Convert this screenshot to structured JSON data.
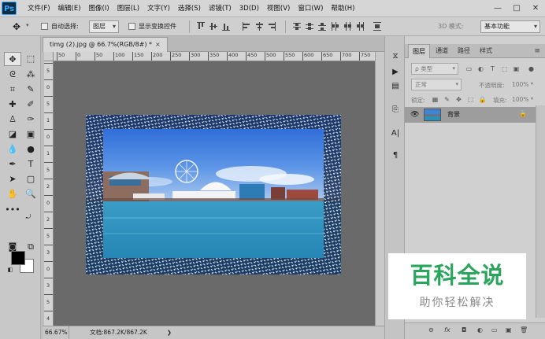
{
  "app": {
    "logo": "Ps",
    "menu": [
      "文件(F)",
      "编辑(E)",
      "图像(I)",
      "图层(L)",
      "文字(Y)",
      "选择(S)",
      "滤镜(T)",
      "3D(D)",
      "视图(V)",
      "窗口(W)",
      "帮助(H)"
    ],
    "window_buttons": [
      "—",
      "□",
      "✕"
    ]
  },
  "options": {
    "auto_select_label": "自动选择:",
    "auto_select_target": "图层",
    "show_transform_label": "显示变换控件",
    "mode_3d_label": "3D 模式:",
    "workspace": "基本功能"
  },
  "document": {
    "tab_title": "timg (2).jpg @ 66.7%(RGB/8#) *",
    "tab_close": "×",
    "ruler_h_ticks": [
      "50",
      "0",
      "50",
      "100",
      "150",
      "200",
      "250",
      "300",
      "350",
      "400",
      "450",
      "500",
      "550",
      "600",
      "650",
      "700",
      "750"
    ],
    "ruler_v_ticks": [
      "5",
      "0",
      "5",
      "1",
      "0",
      "1",
      "5",
      "2",
      "0",
      "2",
      "5",
      "3",
      "0",
      "3",
      "5",
      "4"
    ],
    "colors": {
      "water": "#2f8dbe",
      "sky": "#3d7fe0",
      "frame_noise": "#ffffff"
    }
  },
  "status": {
    "zoom": "66.67%",
    "doc_size": "文档:867.2K/867.2K",
    "arrow": "❯"
  },
  "layers_panel": {
    "tabs": [
      "图层",
      "通道",
      "路径",
      "样式"
    ],
    "menu_icon": "≡",
    "filter_type": "ρ 类型",
    "blend_mode": "正常",
    "opacity_label": "不透明度:",
    "opacity_value": "100%",
    "lock_label": "锁定:",
    "fill_label": "填充:",
    "fill_value": "100%",
    "layers": [
      {
        "name": "背景",
        "visible": true,
        "locked": true
      }
    ],
    "bottom_icons": [
      "⊖",
      "fx",
      "◘",
      "◐",
      "▭",
      "▣",
      "🗑"
    ]
  },
  "watermark": {
    "title": "百科全说",
    "subtitle": "助你轻松解决"
  }
}
